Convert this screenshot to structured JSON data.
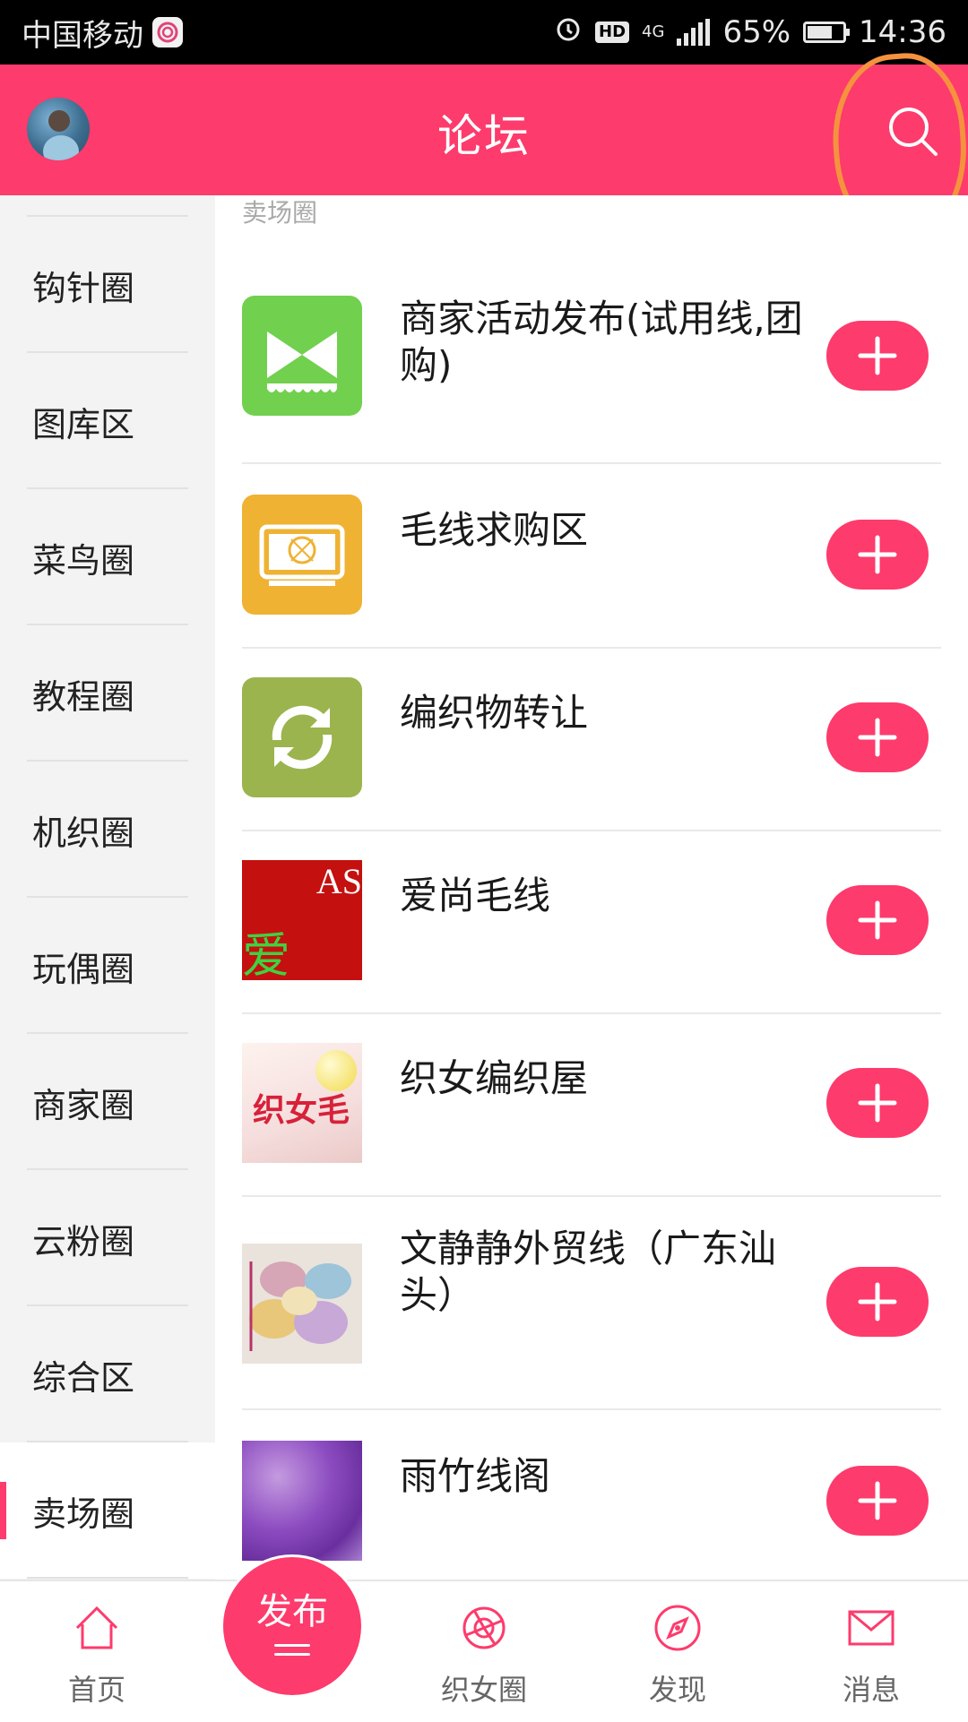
{
  "status_bar": {
    "carrier": "中国移动",
    "network": "4G",
    "hd": "HD",
    "battery": "65%",
    "battery_level": 0.65,
    "time": "14:36"
  },
  "header": {
    "title": "论坛",
    "search_icon": "search-icon",
    "avatar": "user-avatar"
  },
  "sidebar": {
    "items": [
      {
        "label": "钩针圈",
        "active": false
      },
      {
        "label": "图库区",
        "active": false
      },
      {
        "label": "菜鸟圈",
        "active": false
      },
      {
        "label": "教程圈",
        "active": false
      },
      {
        "label": "机织圈",
        "active": false
      },
      {
        "label": "玩偶圈",
        "active": false
      },
      {
        "label": "商家圈",
        "active": false
      },
      {
        "label": "云粉圈",
        "active": false
      },
      {
        "label": "综合区",
        "active": false
      },
      {
        "label": "卖场圈",
        "active": true
      }
    ]
  },
  "main": {
    "section_label": "卖场圈",
    "forums": [
      {
        "title": "商家活动发布(试用线,团购)",
        "thumb_icon": "merchant-event-icon",
        "join_icon": "plus-icon"
      },
      {
        "title": "毛线求购区",
        "thumb_icon": "yarn-purchase-icon",
        "join_icon": "plus-icon"
      },
      {
        "title": "编织物转让",
        "thumb_icon": "transfer-icon",
        "join_icon": "plus-icon"
      },
      {
        "title": "爱尚毛线",
        "thumb_icon": "aishang-logo",
        "thumb_text": "爱",
        "thumb_text2": "AS",
        "join_icon": "plus-icon"
      },
      {
        "title": "织女编织屋",
        "thumb_icon": "zhinv-logo",
        "thumb_text": "织女毛",
        "join_icon": "plus-icon"
      },
      {
        "title": "文静静外贸线（广东汕头）",
        "thumb_icon": "yarn-photo",
        "join_icon": "plus-icon"
      },
      {
        "title": "雨竹线阁",
        "thumb_icon": "purple-yarn-photo",
        "join_icon": "plus-icon"
      }
    ]
  },
  "bottom_nav": {
    "home": {
      "label": "首页",
      "icon": "home-icon"
    },
    "publish": {
      "label": "发布",
      "icon": "menu-lines-icon"
    },
    "circle": {
      "label": "织女圈",
      "icon": "aperture-icon"
    },
    "discover": {
      "label": "发现",
      "icon": "compass-icon"
    },
    "messages": {
      "label": "消息",
      "icon": "mail-icon"
    }
  },
  "colors": {
    "brand": "#fd3b6c",
    "annotation": "#f5923e"
  }
}
